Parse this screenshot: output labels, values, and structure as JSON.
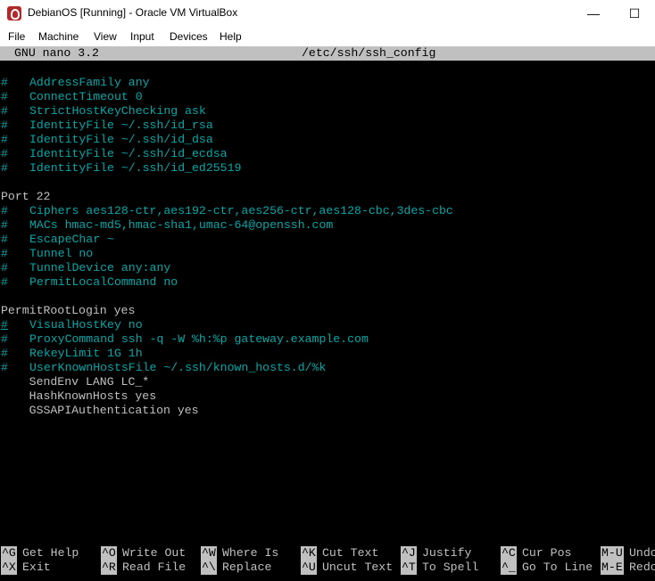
{
  "window": {
    "title": "DebianOS [Running] - Oracle VM VirtualBox",
    "minimize_glyph": "—",
    "maximize_glyph": "☐",
    "colors": {
      "titlebar": "#ffffff",
      "terminal_bg": "#000000",
      "comment": "#00a8a8",
      "text": "#c0c0c0",
      "header_bg": "#c0c0c0"
    }
  },
  "menubar": {
    "file": "File",
    "machine": "Machine",
    "view": "View",
    "input": "Input",
    "devices": "Devices",
    "help": "Help"
  },
  "nano": {
    "version": "GNU nano 3.2",
    "filename": "/etc/ssh/ssh_config"
  },
  "editor": {
    "lines": [
      {
        "hash": "#",
        "text": "AddressFamily any"
      },
      {
        "hash": "#",
        "text": "ConnectTimeout 0"
      },
      {
        "hash": "#",
        "text": "StrictHostKeyChecking ask"
      },
      {
        "hash": "#",
        "text": "IdentityFile ~/.ssh/id_rsa"
      },
      {
        "hash": "#",
        "text": "IdentityFile ~/.ssh/id_dsa"
      },
      {
        "hash": "#",
        "text": "IdentityFile ~/.ssh/id_ecdsa"
      },
      {
        "hash": "#",
        "text": "IdentityFile ~/.ssh/id_ed25519"
      },
      {
        "plain": "Port 22"
      },
      {
        "hash": "#",
        "text": "Ciphers aes128-ctr,aes192-ctr,aes256-ctr,aes128-cbc,3des-cbc"
      },
      {
        "hash": "#",
        "text": "MACs hmac-md5,hmac-sha1,umac-64@openssh.com"
      },
      {
        "hash": "#",
        "text": "EscapeChar ~"
      },
      {
        "hash": "#",
        "text": "Tunnel no"
      },
      {
        "hash": "#",
        "text": "TunnelDevice any:any"
      },
      {
        "hash": "#",
        "text": "PermitLocalCommand no"
      },
      {
        "plain": "PermitRootLogin yes"
      },
      {
        "hash": "#",
        "text": "VisualHostKey no"
      },
      {
        "hash": "#",
        "text": "ProxyCommand ssh -q -W %h:%p gateway.example.com"
      },
      {
        "hash": "#",
        "text": "RekeyLimit 1G 1h"
      },
      {
        "hash": "#",
        "text": "UserKnownHostsFile ~/.ssh/known_hosts.d/%k"
      },
      {
        "plain": "    SendEnv LANG LC_*"
      },
      {
        "plain": "    HashKnownHosts yes"
      },
      {
        "plain": "    GSSAPIAuthentication yes"
      }
    ]
  },
  "shortcuts": [
    {
      "key": "^G",
      "label": "Get Help"
    },
    {
      "key": "^X",
      "label": "Exit"
    },
    {
      "key": "^O",
      "label": "Write Out"
    },
    {
      "key": "^R",
      "label": "Read File"
    },
    {
      "key": "^W",
      "label": "Where Is"
    },
    {
      "key": "^\\",
      "label": "Replace"
    },
    {
      "key": "^K",
      "label": "Cut Text"
    },
    {
      "key": "^U",
      "label": "Uncut Text"
    },
    {
      "key": "^J",
      "label": "Justify"
    },
    {
      "key": "^T",
      "label": "To Spell"
    },
    {
      "key": "^C",
      "label": "Cur Pos"
    },
    {
      "key": "^_",
      "label": "Go To Line"
    },
    {
      "key": "M-U",
      "label": "Undo"
    },
    {
      "key": "M-E",
      "label": "Redo"
    }
  ]
}
